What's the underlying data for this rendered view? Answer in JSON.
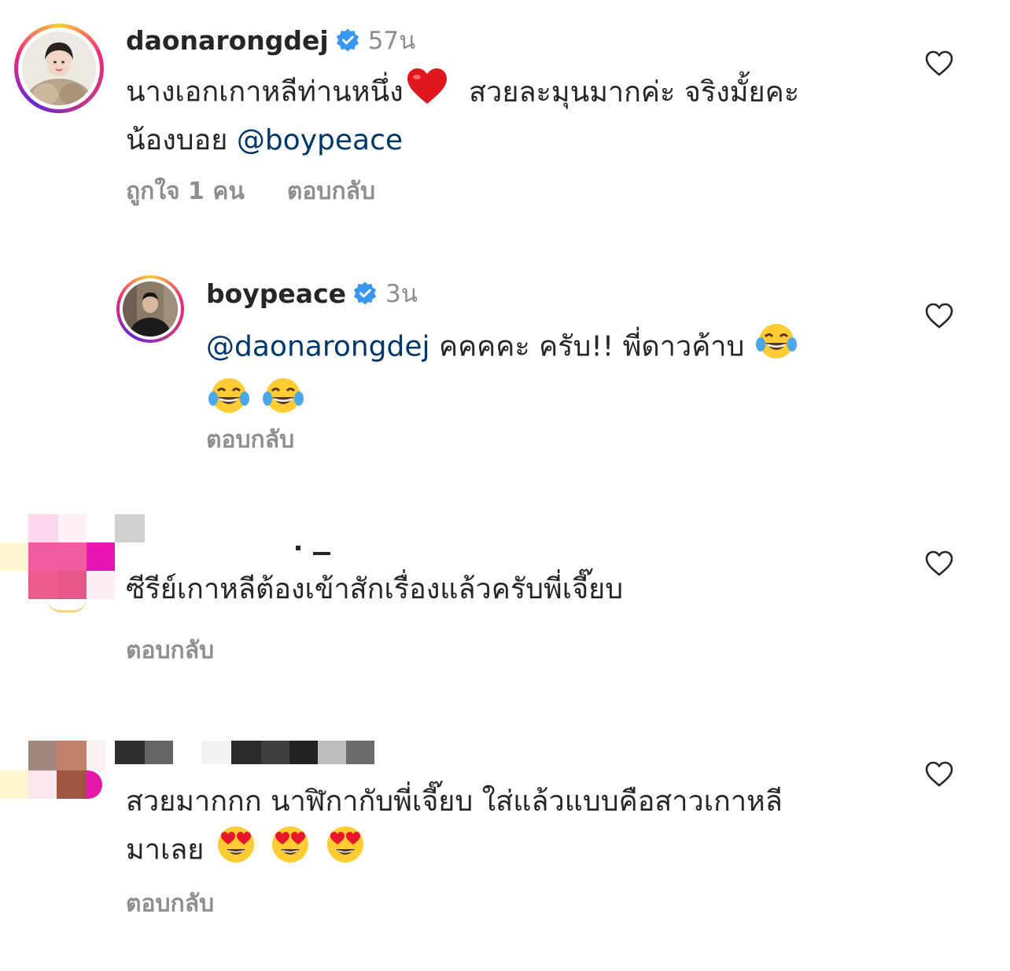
{
  "comments": [
    {
      "username": "daonarongdej",
      "verified": true,
      "time": "57น",
      "text_line1": "นางเอกเกาหลีท่านหนึ่ง",
      "text_line1b": "สวยละมุนมากค่ะ จริงมั้ยคะ",
      "text_line2_prefix": "น้องบอย",
      "mention": "@boypeace",
      "likes": "ถูกใจ 1 คน",
      "reply": "ตอบกลับ"
    },
    {
      "username": "boypeace",
      "verified": true,
      "time": "3น",
      "mention": "@daonarongdej",
      "text": "คคคคะ ครับ!! พี่ดาวค้าบ",
      "reply": "ตอบกลับ"
    },
    {
      "text": "ซีรีย์เกาหลีต้องเข้าสักเรื่องแล้วครับพี่เจี๊ยบ",
      "reply": "ตอบกลับ"
    },
    {
      "text_line1": "สวยมากกก นาฬิกากับพี่เจี๊ยบ ใส่แล้วแบบคือสาวเกาหลี",
      "text_line2": "มาเลย",
      "reply": "ตอบกลับ"
    }
  ],
  "icons": {
    "like": "heart-outline-icon",
    "verified": "verified-badge-icon",
    "heart_emoji": "red-heart-emoji",
    "laugh_emoji": "tears-of-joy-emoji",
    "heart_eyes_emoji": "heart-eyes-emoji"
  },
  "colors": {
    "mention": "#00376b",
    "secondary": "#8e8e8e",
    "verified": "#3897f0"
  }
}
